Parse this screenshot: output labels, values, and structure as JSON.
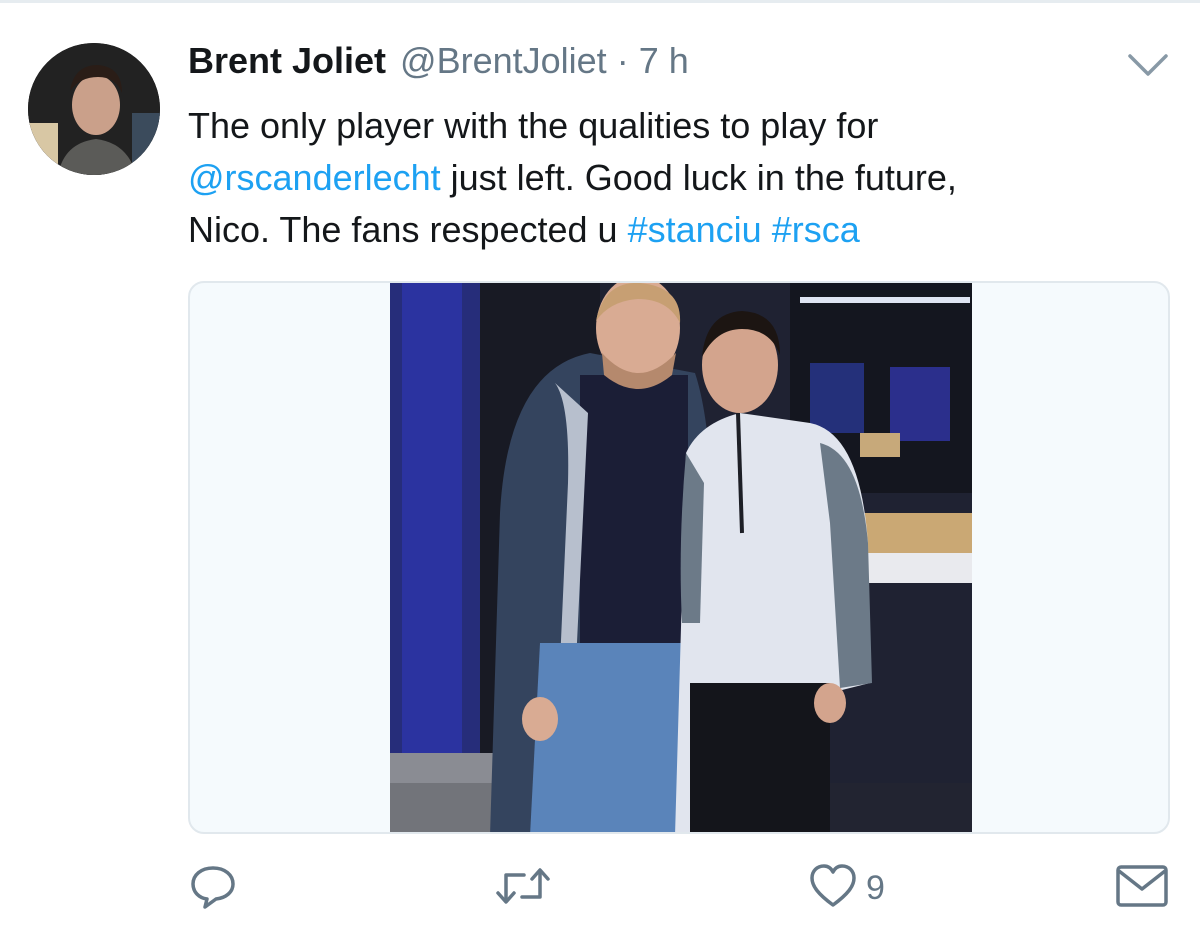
{
  "tweet": {
    "author_name": "Brent Joliet",
    "author_handle": "@BrentJoliet",
    "separator": "·",
    "timestamp": "7 h",
    "text_line1": "The only player with the qualities to play for",
    "mention": "@rscanderlecht",
    "text_line2_rest": " just left. Good luck in the future,",
    "text_line3": "Nico. The fans respected u ",
    "hashtag1": "#stanciu",
    "hashtag_space": " ",
    "hashtag2": "#rsca"
  },
  "actions": {
    "reply_icon": "reply-icon",
    "retweet_icon": "retweet-icon",
    "like_icon": "heart-icon",
    "like_count": "9",
    "dm_icon": "mail-icon"
  },
  "colors": {
    "link": "#1da1f2",
    "secondary_text": "#657786",
    "primary_text": "#14171a",
    "border": "#e1e8ed"
  }
}
